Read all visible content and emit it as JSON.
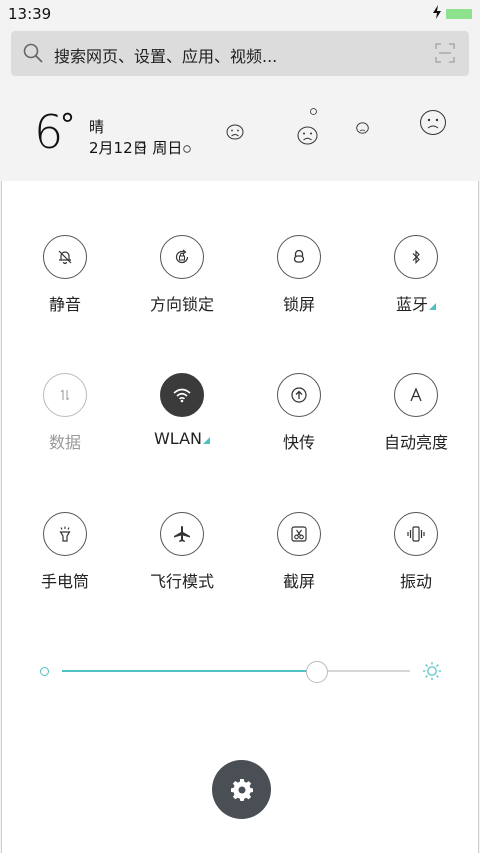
{
  "status_bar": {
    "time": "13:39",
    "battery_color": "#8ee28e"
  },
  "search": {
    "placeholder": "搜索网页、设置、应用、视频..."
  },
  "weather": {
    "temperature": "6",
    "degree_symbol": "°",
    "condition": "晴",
    "date": "2月12日 周日"
  },
  "tiles": [
    {
      "label": "静音",
      "icon": "bell-off-icon"
    },
    {
      "label": "方向锁定",
      "icon": "rotation-lock-icon"
    },
    {
      "label": "锁屏",
      "icon": "lock-icon"
    },
    {
      "label": "蓝牙",
      "icon": "bluetooth-icon"
    },
    {
      "label": "数据",
      "icon": "mobile-data-icon"
    },
    {
      "label": "WLAN",
      "icon": "wifi-icon"
    },
    {
      "label": "快传",
      "icon": "quick-share-icon"
    },
    {
      "label": "自动亮度",
      "icon": "auto-brightness-icon"
    },
    {
      "label": "手电筒",
      "icon": "flashlight-icon"
    },
    {
      "label": "飞行模式",
      "icon": "airplane-icon"
    },
    {
      "label": "截屏",
      "icon": "screenshot-icon"
    },
    {
      "label": "振动",
      "icon": "vibrate-icon"
    }
  ],
  "brightness": {
    "level": 0.73
  },
  "colors": {
    "accent": "#4fc1c4",
    "fab": "#4a4f55"
  }
}
